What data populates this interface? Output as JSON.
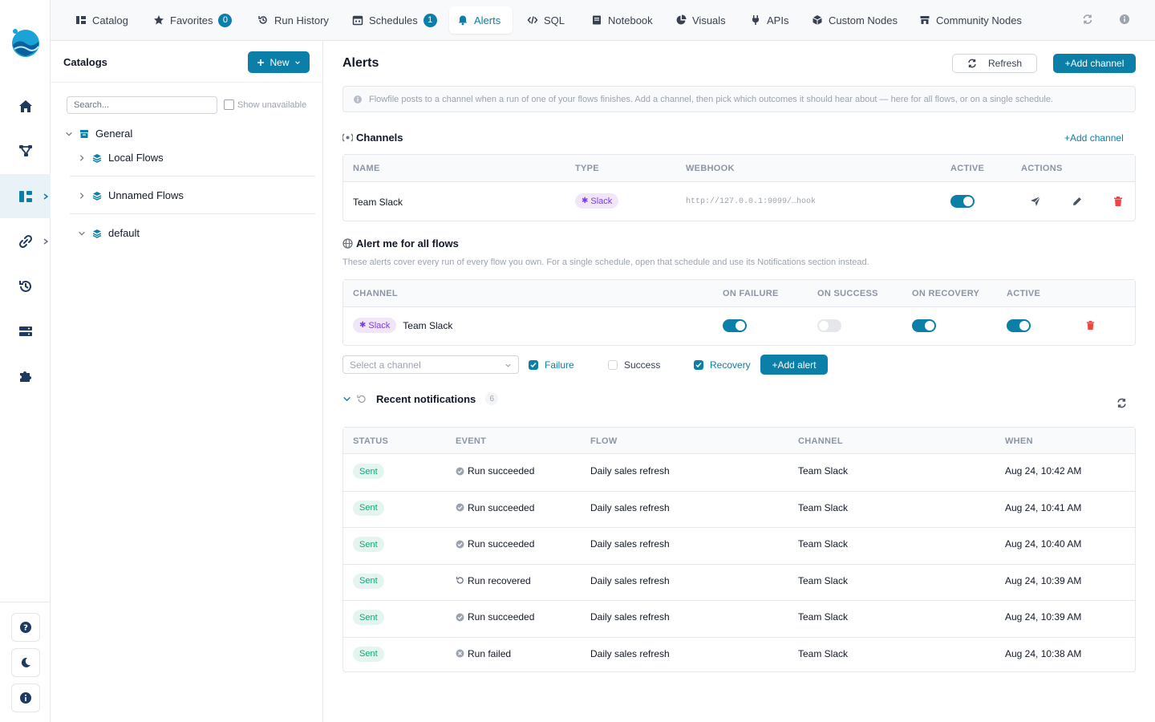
{
  "top_nav": {
    "tabs": [
      {
        "label": "Catalog",
        "icon": "catalog-icon"
      },
      {
        "label": "Favorites",
        "icon": "star-icon",
        "badge": "0"
      },
      {
        "label": "Run History",
        "icon": "history-icon"
      },
      {
        "label": "Schedules",
        "icon": "calendar-icon",
        "badge": "1"
      },
      {
        "label": "Alerts",
        "icon": "bell-icon",
        "active": true
      },
      {
        "label": "SQL",
        "icon": "code-icon"
      },
      {
        "label": "Notebook",
        "icon": "notebook-icon"
      },
      {
        "label": "Visuals",
        "icon": "pie-chart-icon"
      },
      {
        "label": "APIs",
        "icon": "plug-icon"
      },
      {
        "label": "Custom Nodes",
        "icon": "cube-icon"
      },
      {
        "label": "Community Nodes",
        "icon": "store-icon"
      }
    ]
  },
  "catalog": {
    "title": "Catalogs",
    "new_label": "New",
    "search_placeholder": "Search...",
    "show_unavailable": "Show unavailable",
    "tree": {
      "root": "General",
      "children": [
        "Local Flows",
        "Unnamed Flows",
        "default"
      ]
    }
  },
  "alerts": {
    "title": "Alerts",
    "refresh_label": "Refresh",
    "add_channel_label": "+Add channel",
    "info_text": "Flowfile posts to a channel when a run of one of your flows finishes. Add a channel, then pick which outcomes it should hear about — here for all flows, or on a single schedule.",
    "channels": {
      "title": "Channels",
      "add_label": "+Add channel",
      "headers": [
        "NAME",
        "TYPE",
        "WEBHOOK",
        "ACTIVE",
        "ACTIONS"
      ],
      "rows": [
        {
          "name": "Team Slack",
          "type": "Slack",
          "webhook": "http://127.0.0.1:9099/…hook",
          "active": true
        }
      ]
    },
    "all_flows": {
      "title": "Alert me for all flows",
      "description": "These alerts cover every run of every flow you own. For a single schedule, open that schedule and use its Notifications section instead.",
      "headers": [
        "CHANNEL",
        "ON FAILURE",
        "ON SUCCESS",
        "ON RECOVERY",
        "ACTIVE"
      ],
      "rows": [
        {
          "type": "Slack",
          "channel": "Team Slack",
          "on_failure": true,
          "on_success": false,
          "on_recovery": true,
          "active": true
        }
      ],
      "select_placeholder": "Select a channel",
      "checks": [
        {
          "label": "Failure",
          "checked": true
        },
        {
          "label": "Success",
          "checked": false
        },
        {
          "label": "Recovery",
          "checked": true
        }
      ],
      "add_alert_label": "+Add alert"
    },
    "recent": {
      "title": "Recent notifications",
      "count": "6",
      "headers": [
        "STATUS",
        "EVENT",
        "FLOW",
        "CHANNEL",
        "WHEN"
      ],
      "rows": [
        {
          "status": "Sent",
          "event": "Run succeeded",
          "event_icon": "success-circle-icon",
          "flow": "Daily sales refresh",
          "channel": "Team Slack",
          "when": "Aug 24, 10:42 AM"
        },
        {
          "status": "Sent",
          "event": "Run succeeded",
          "event_icon": "success-circle-icon",
          "flow": "Daily sales refresh",
          "channel": "Team Slack",
          "when": "Aug 24, 10:41 AM"
        },
        {
          "status": "Sent",
          "event": "Run succeeded",
          "event_icon": "success-circle-icon",
          "flow": "Daily sales refresh",
          "channel": "Team Slack",
          "when": "Aug 24, 10:40 AM"
        },
        {
          "status": "Sent",
          "event": "Run recovered",
          "event_icon": "recovered-icon",
          "flow": "Daily sales refresh",
          "channel": "Team Slack",
          "when": "Aug 24, 10:39 AM"
        },
        {
          "status": "Sent",
          "event": "Run succeeded",
          "event_icon": "success-circle-icon",
          "flow": "Daily sales refresh",
          "channel": "Team Slack",
          "when": "Aug 24, 10:39 AM"
        },
        {
          "status": "Sent",
          "event": "Run failed",
          "event_icon": "failed-circle-icon",
          "flow": "Daily sales refresh",
          "channel": "Team Slack",
          "when": "Aug 24, 10:38 AM"
        }
      ]
    }
  },
  "colors": {
    "accent": "#0b7fa8",
    "slack": "#7c3aed",
    "sent": "#16a37a",
    "danger": "#ef4444"
  }
}
